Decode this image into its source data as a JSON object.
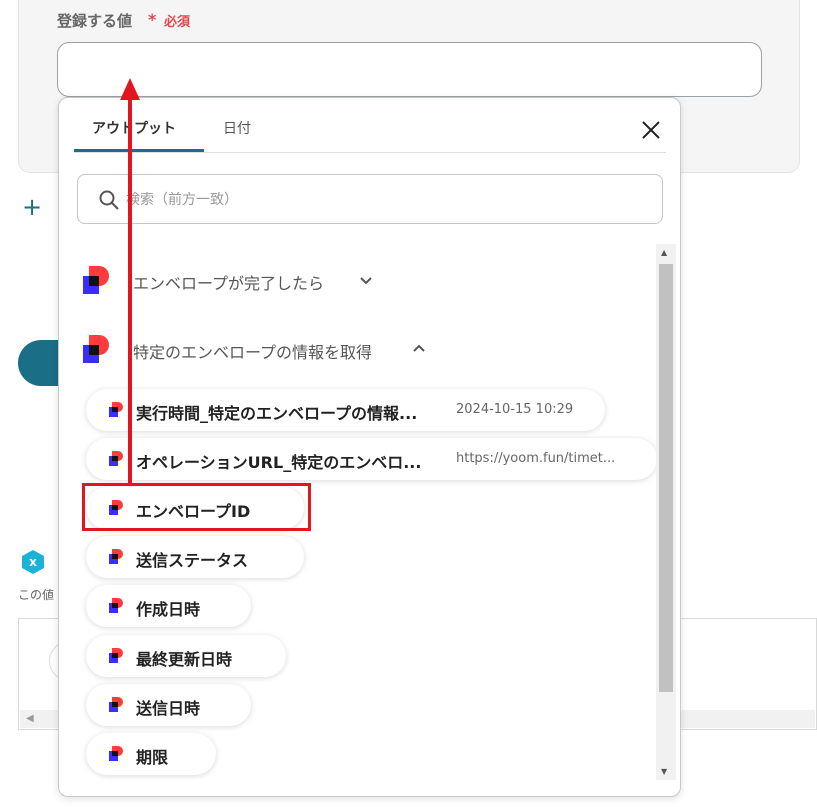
{
  "form": {
    "field_label": "登録する値",
    "required_mark": "*",
    "required_text": "必須",
    "input_value": ""
  },
  "background": {
    "hint_text": "この値"
  },
  "popup": {
    "tabs": [
      {
        "label": "アウトプット",
        "active": true
      },
      {
        "label": "日付",
        "active": false
      }
    ],
    "search_placeholder": "検索（前方一致）",
    "sections": [
      {
        "label": "エンベロープが完了したら",
        "expanded": false
      },
      {
        "label": "特定のエンベロープの情報を取得",
        "expanded": true
      }
    ],
    "items": [
      {
        "label": "実行時間_特定のエンベロープの情報...",
        "value": "2024-10-15 10:29"
      },
      {
        "label": "オペレーションURL_特定のエンベロ...",
        "value": "https://yoom.fun/timet..."
      },
      {
        "label": "エンベロープID",
        "value": "",
        "highlighted": true
      },
      {
        "label": "送信ステータス",
        "value": ""
      },
      {
        "label": "作成日時",
        "value": ""
      },
      {
        "label": "最終更新日時",
        "value": ""
      },
      {
        "label": "送信日時",
        "value": ""
      },
      {
        "label": "期限",
        "value": ""
      }
    ]
  },
  "colors": {
    "accent": "#1a6f86",
    "required": "#e5484d",
    "annotation_red": "#e3161f",
    "app_icon_red": "#ff3b3b",
    "app_icon_purple": "#3b2cff"
  },
  "icons": {
    "close": "close-icon",
    "search": "search-icon",
    "section_app": "docusign-like-app-icon",
    "chevron_down": "chevron-down-icon",
    "chevron_up": "chevron-up-icon",
    "add": "plus-icon"
  }
}
